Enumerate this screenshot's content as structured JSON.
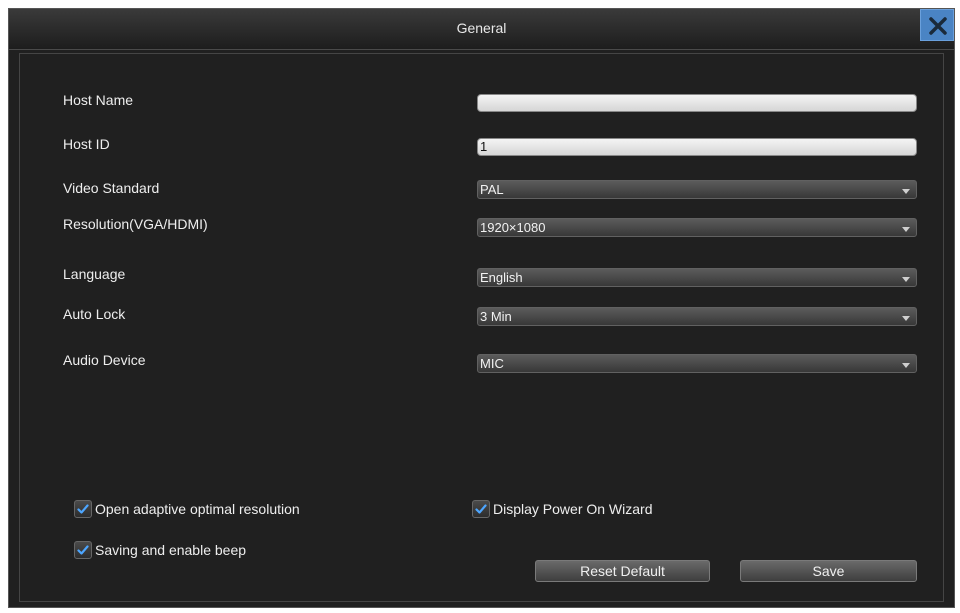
{
  "window": {
    "title": "General"
  },
  "form": {
    "host_name": {
      "label": "Host Name",
      "value": ""
    },
    "host_id": {
      "label": "Host ID",
      "value": "1"
    },
    "video_standard": {
      "label": "Video Standard",
      "value": "PAL"
    },
    "resolution": {
      "label": "Resolution(VGA/HDMI)",
      "value": "1920×1080"
    },
    "language": {
      "label": "Language",
      "value": "English"
    },
    "auto_lock": {
      "label": "Auto Lock",
      "value": "3 Min"
    },
    "audio_device": {
      "label": "Audio Device",
      "value": "MIC"
    }
  },
  "options": {
    "adaptive_resolution": {
      "label": "Open adaptive optimal resolution",
      "checked": true
    },
    "power_on_wizard": {
      "label": "Display Power On Wizard",
      "checked": true
    },
    "enable_beep": {
      "label": "Saving and enable beep",
      "checked": true
    }
  },
  "buttons": {
    "reset": "Reset Default",
    "save": "Save"
  },
  "colors": {
    "background": "#202020",
    "accent": "#4a84c4",
    "checkmark": "#4da6ff"
  }
}
